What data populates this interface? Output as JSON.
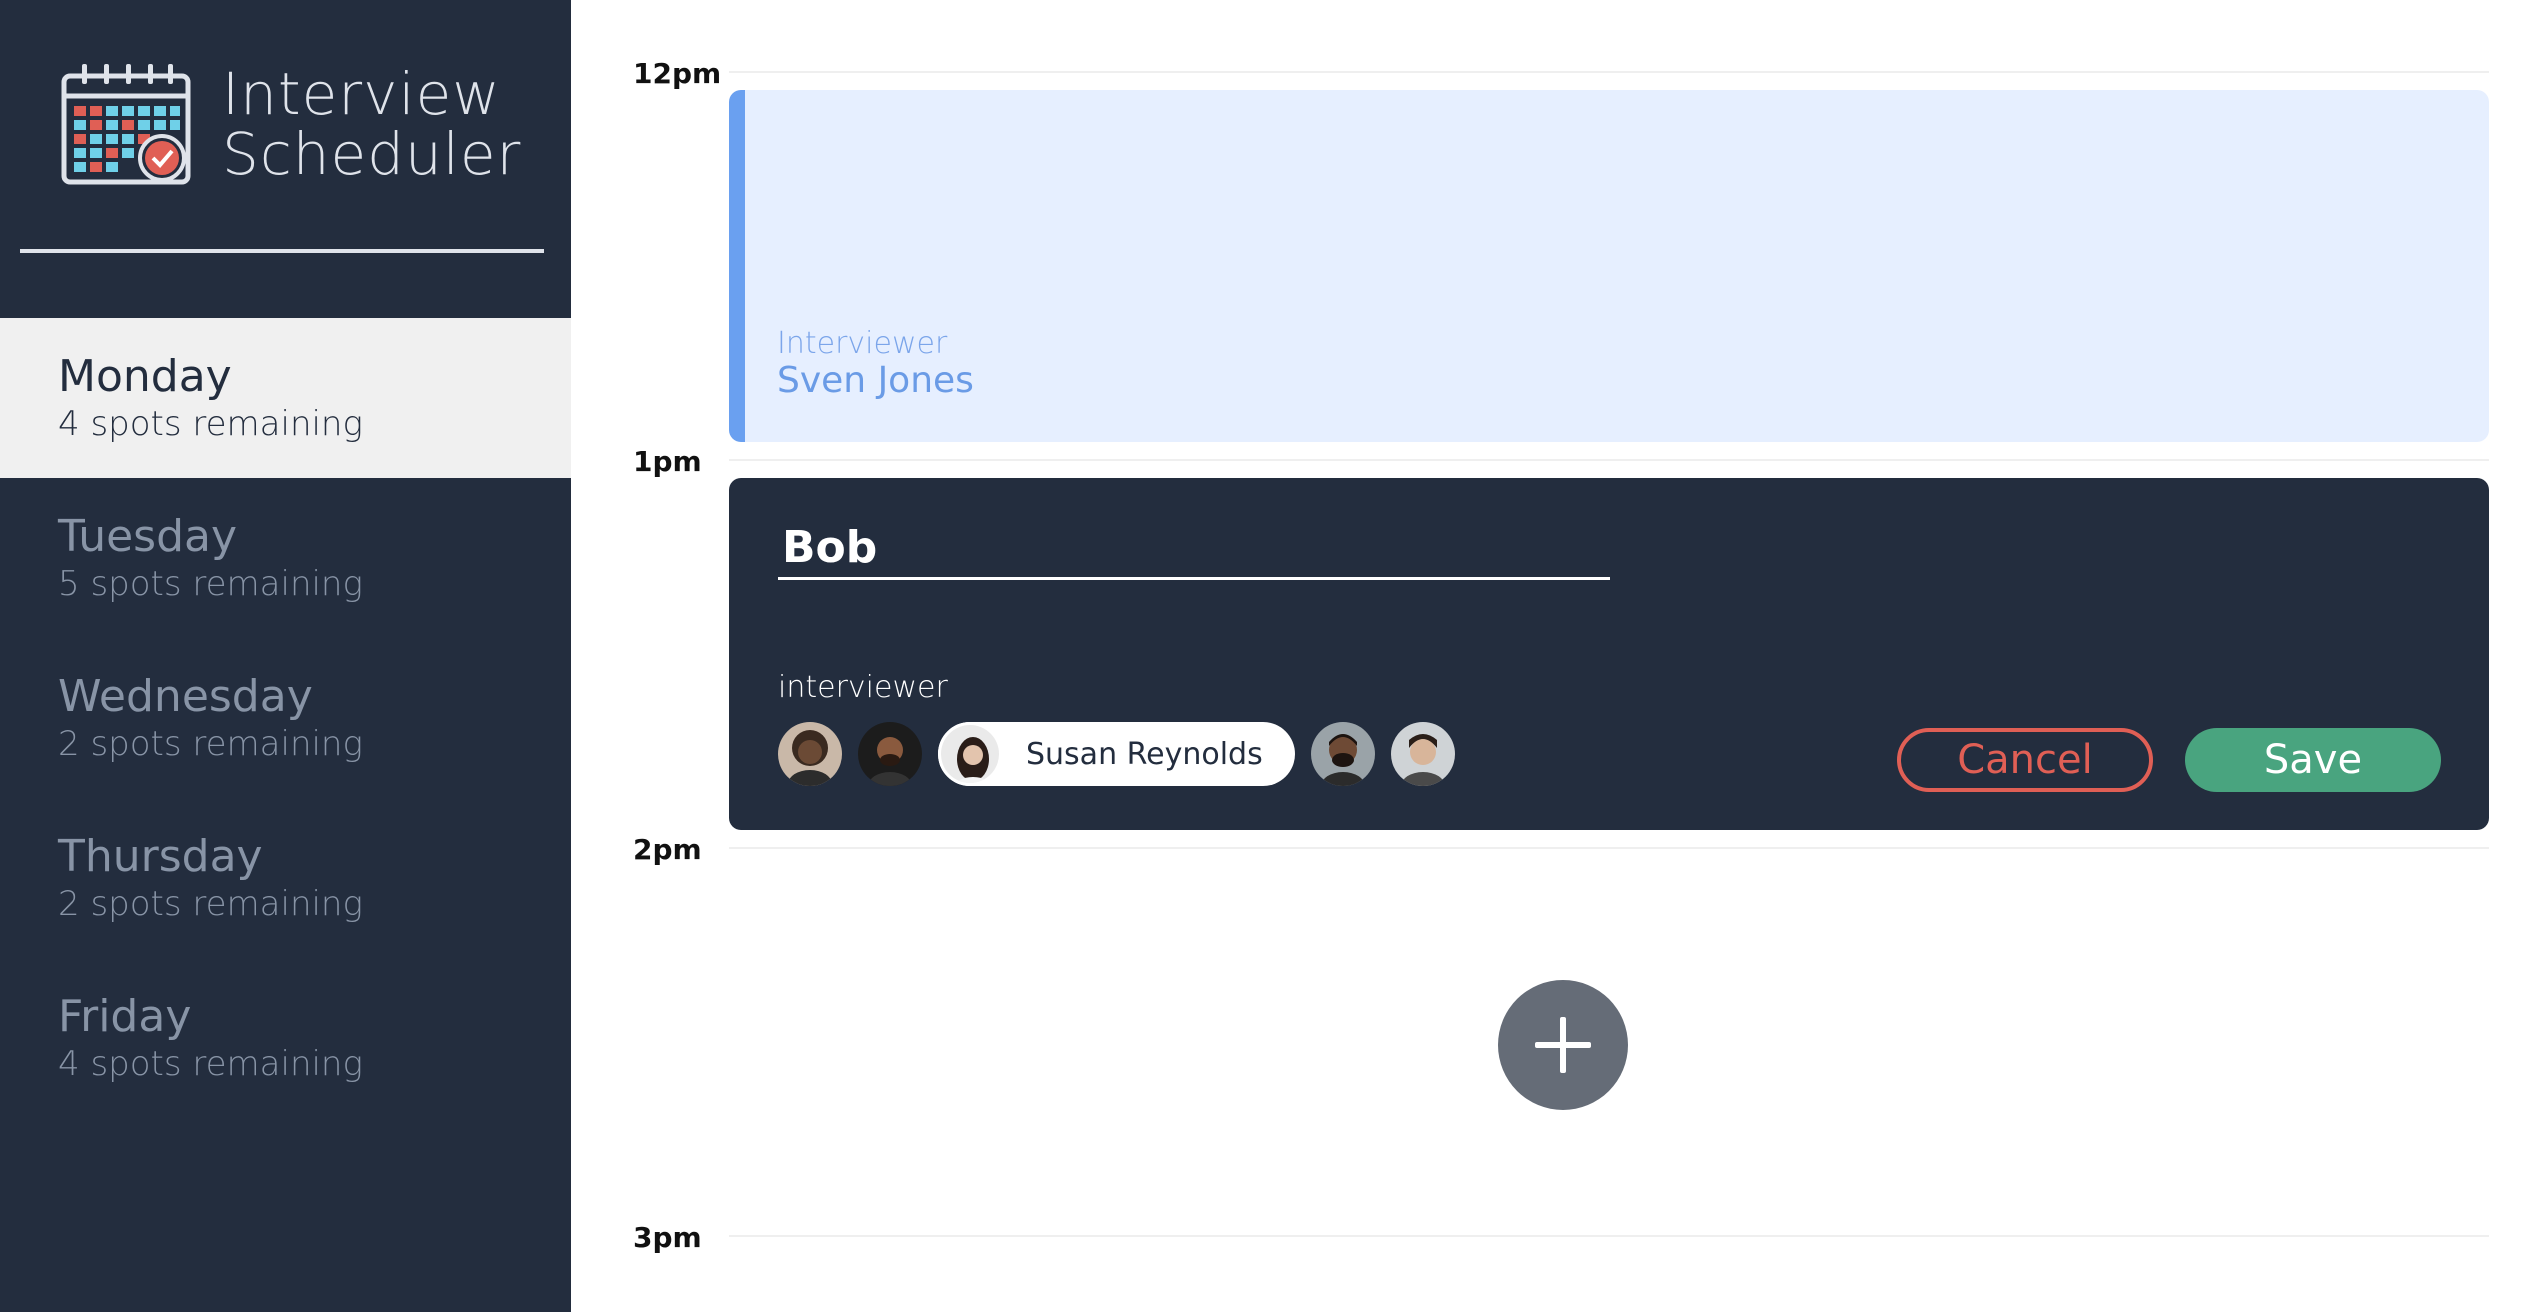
{
  "app": {
    "title_line1": "Interview",
    "title_line2": "Scheduler",
    "logo_icon": "calendar-check-icon"
  },
  "days": [
    {
      "name": "Monday",
      "spots": "4 spots remaining",
      "selected": true
    },
    {
      "name": "Tuesday",
      "spots": "5 spots remaining",
      "selected": false
    },
    {
      "name": "Wednesday",
      "spots": "2 spots remaining",
      "selected": false
    },
    {
      "name": "Thursday",
      "spots": "2 spots remaining",
      "selected": false
    },
    {
      "name": "Friday",
      "spots": "4 spots remaining",
      "selected": false
    }
  ],
  "schedule": {
    "times": [
      "12pm",
      "1pm",
      "2pm",
      "3pm"
    ],
    "booked": {
      "interviewer_label": "Interviewer",
      "interviewer_name": "Sven Jones"
    },
    "form": {
      "student_name": "Bob",
      "interviewer_label": "interviewer",
      "selected_interviewer": "Susan Reynolds",
      "cancel_label": "Cancel",
      "save_label": "Save"
    },
    "add_icon": "plus-icon"
  },
  "colors": {
    "sidebar": "#232d3e",
    "selected_day": "#f0f0f0",
    "booked_bg": "#e6efff",
    "booked_accent": "#6aa0f0",
    "cancel": "#e05f55",
    "save": "#49a47f",
    "add_button": "#656c77"
  }
}
